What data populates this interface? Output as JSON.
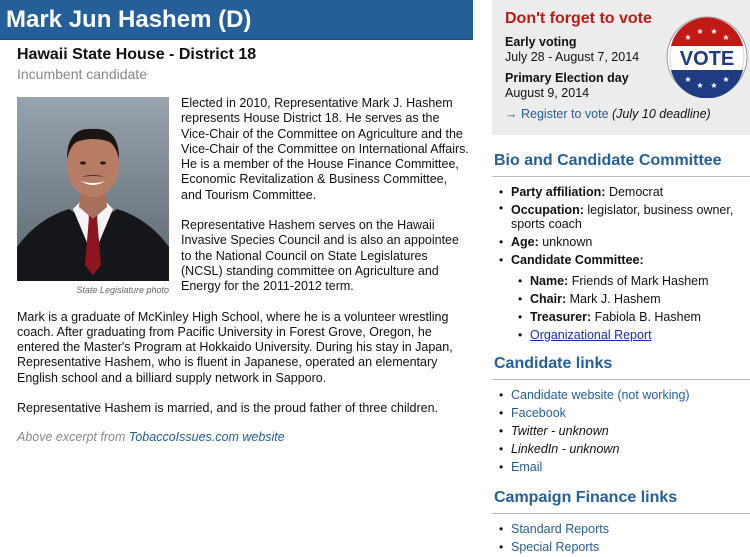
{
  "candidate": {
    "name": "Mark Jun Hashem (D)",
    "office": "Hawaii State House - District 18",
    "status": "Incumbent candidate"
  },
  "photo": {
    "caption": "State Legislature photo"
  },
  "bio": {
    "paragraphs": [
      "Elected in 2010, Representative Mark J. Hashem represents House District 18. He serves as the Vice-Chair of the Committee on Agriculture and the Vice-Chair of the Committee on International Affairs. He is a member of the House Finance Committee, Economic Revitalization & Business Committee, and Tourism Committee.",
      "Representative Hashem serves on the Hawaii Invasive Species Council and is also an appointee to the National Council on State Legislatures (NCSL) standing committee on Agriculture and Energy for the 2011-2012 term.",
      "Mark is a graduate of McKinley High School, where he is a volunteer wrestling coach. After graduating from Pacific University in Forest Grove, Oregon, he entered the Master's Program at Hokkaido University. During his stay in Japan, Representative Hashem, who is fluent in Japanese, operated an elementary English school and a billiard supply network in Sapporo.",
      "Representative Hashem is married, and is the proud father of three children."
    ],
    "excerpt_prefix": "Above excerpt from ",
    "excerpt_link": "TobaccoIssues.com website"
  },
  "vote_box": {
    "heading": "Don't forget to vote",
    "early_label": "Early voting",
    "early_dates": "July 28 - August 7, 2014",
    "primary_label": "Primary Election day",
    "primary_date": "August 9, 2014",
    "register_arrow": "→",
    "register_link": "Register to vote",
    "register_note": "(July 10 deadline)",
    "badge_text": "VOTE",
    "colors": {
      "heading": "#c11a14",
      "badge_red": "#c11a14",
      "badge_blue": "#1f3b82"
    }
  },
  "bio_committee": {
    "heading": "Bio and Candidate Committee",
    "party_label": "Party affiliation:",
    "party_value": "Democrat",
    "occupation_label": "Occupation:",
    "occupation_value": "legislator, business owner, sports coach",
    "age_label": "Age:",
    "age_value": "unknown",
    "committee_label": "Candidate Committee:",
    "committee": {
      "name_label": "Name:",
      "name_value": "Friends of Mark Hashem",
      "chair_label": "Chair:",
      "chair_value": "Mark J. Hashem",
      "treasurer_label": "Treasurer:",
      "treasurer_value": "Fabiola B. Hashem",
      "report_link": "Organizational Report"
    }
  },
  "candidate_links": {
    "heading": "Candidate links",
    "website": "Candidate website (not working)",
    "facebook": "Facebook",
    "twitter": "Twitter - unknown",
    "linkedin": "LinkedIn - unknown",
    "email": "Email"
  },
  "finance_links": {
    "heading": "Campaign Finance links",
    "standard": "Standard Reports",
    "special": "Special Reports"
  },
  "colors": {
    "accent": "#245f9a",
    "link_underlined": "#1a2db3",
    "muted": "#888888",
    "panel": "#ececec"
  }
}
